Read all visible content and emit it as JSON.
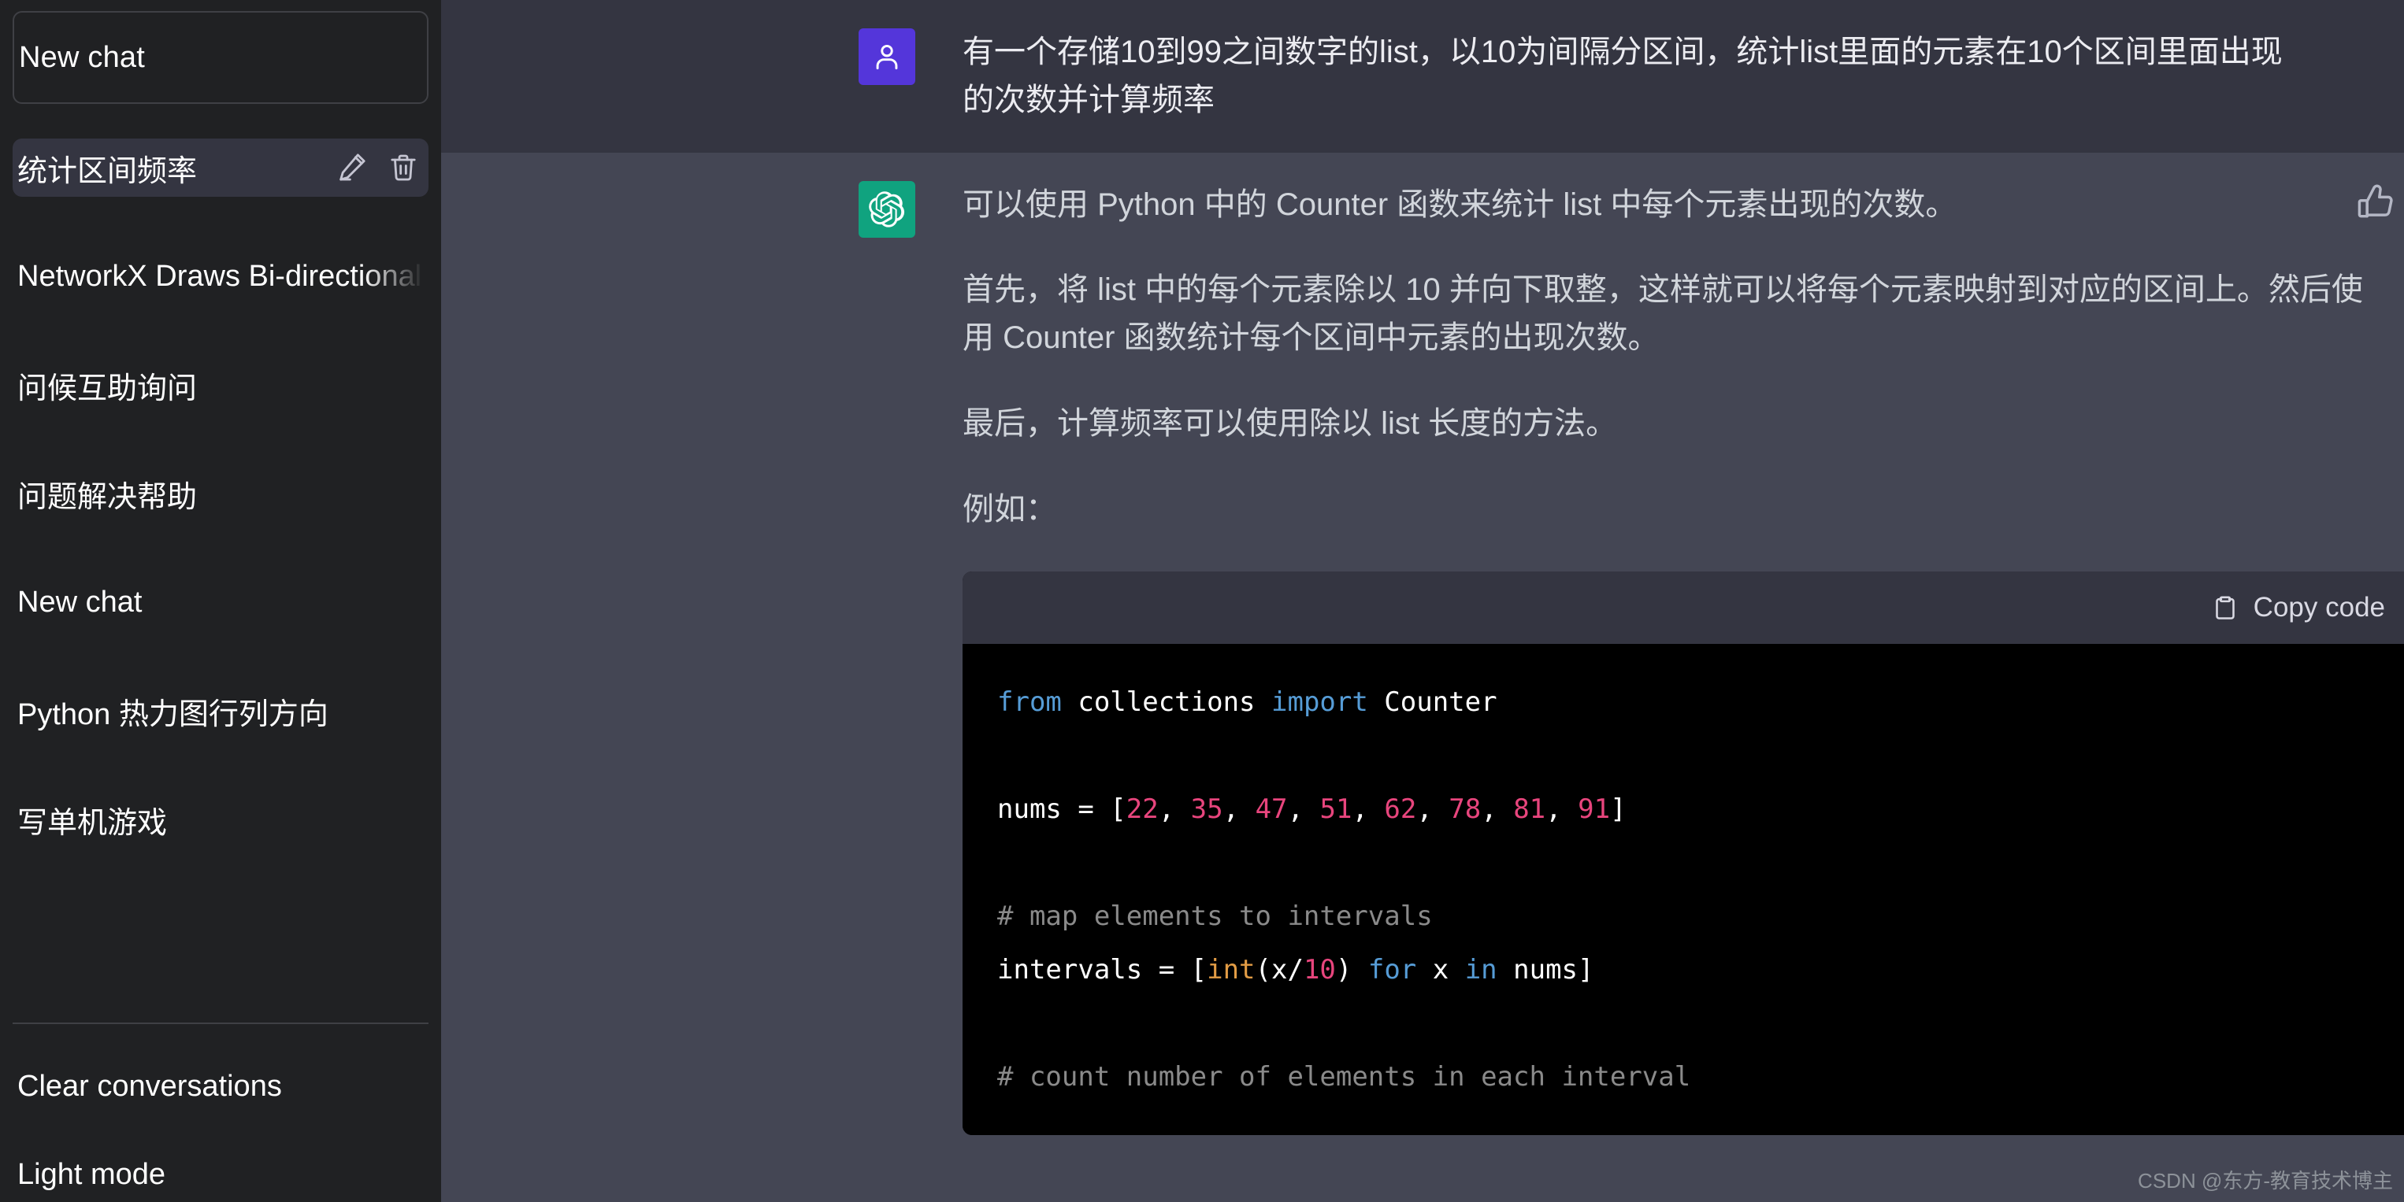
{
  "sidebar": {
    "new_chat_label": "New chat",
    "conversations": [
      {
        "title": "统计区间频率",
        "active": true,
        "edit_icon": "pencil-icon",
        "delete_icon": "trash-icon"
      },
      {
        "title": "NetworkX Draws Bi-directional Edges",
        "active": false
      },
      {
        "title": "问候互助询问",
        "active": false
      },
      {
        "title": "问题解决帮助",
        "active": false
      },
      {
        "title": "New chat",
        "active": false
      },
      {
        "title": "Python 热力图行列方向",
        "active": false
      },
      {
        "title": "写单机游戏",
        "active": false
      }
    ],
    "footer_items": [
      {
        "label": "Clear conversations"
      },
      {
        "label": "Light mode"
      }
    ]
  },
  "conversation": {
    "user_message": {
      "avatar_icon": "user-avatar-icon",
      "avatar_color": "#5436DA",
      "text": "有一个存储10到99之间数字的list，以10为间隔分区间，统计list里面的元素在10个区间里面出现的次数并计算频率"
    },
    "assistant_message": {
      "avatar_icon": "openai-logo-icon",
      "avatar_color": "#10A37F",
      "like_icon": "thumbs-up-icon",
      "paragraphs": [
        "可以使用 Python 中的 Counter 函数来统计 list 中每个元素出现的次数。",
        "首先，将 list 中的每个元素除以 10 并向下取整，这样就可以将每个元素映射到对应的区间上。然后使用 Counter 函数统计每个区间中元素的出现次数。",
        "最后，计算频率可以使用除以 list 长度的方法。",
        "例如："
      ],
      "code_block": {
        "copy_label": "Copy code",
        "copy_icon": "clipboard-icon",
        "lines": [
          [
            {
              "t": "from",
              "c": "kw"
            },
            {
              "t": " collections ",
              "c": "plain"
            },
            {
              "t": "import",
              "c": "kw"
            },
            {
              "t": " Counter",
              "c": "plain"
            }
          ],
          [
            {
              "t": "",
              "c": "plain"
            }
          ],
          [
            {
              "t": "nums = [",
              "c": "plain"
            },
            {
              "t": "22",
              "c": "num"
            },
            {
              "t": ", ",
              "c": "plain"
            },
            {
              "t": "35",
              "c": "num"
            },
            {
              "t": ", ",
              "c": "plain"
            },
            {
              "t": "47",
              "c": "num"
            },
            {
              "t": ", ",
              "c": "plain"
            },
            {
              "t": "51",
              "c": "num"
            },
            {
              "t": ", ",
              "c": "plain"
            },
            {
              "t": "62",
              "c": "num"
            },
            {
              "t": ", ",
              "c": "plain"
            },
            {
              "t": "78",
              "c": "num"
            },
            {
              "t": ", ",
              "c": "plain"
            },
            {
              "t": "81",
              "c": "num"
            },
            {
              "t": ", ",
              "c": "plain"
            },
            {
              "t": "91",
              "c": "num"
            },
            {
              "t": "]",
              "c": "plain"
            }
          ],
          [
            {
              "t": "",
              "c": "plain"
            }
          ],
          [
            {
              "t": "# map elements to intervals",
              "c": "cmt"
            }
          ],
          [
            {
              "t": "intervals = [",
              "c": "plain"
            },
            {
              "t": "int",
              "c": "fn"
            },
            {
              "t": "(x/",
              "c": "plain"
            },
            {
              "t": "10",
              "c": "num"
            },
            {
              "t": ") ",
              "c": "plain"
            },
            {
              "t": "for",
              "c": "kw"
            },
            {
              "t": " x ",
              "c": "plain"
            },
            {
              "t": "in",
              "c": "kw"
            },
            {
              "t": " nums]",
              "c": "plain"
            }
          ],
          [
            {
              "t": "",
              "c": "plain"
            }
          ],
          [
            {
              "t": "# count number of elements in each interval",
              "c": "cmt"
            }
          ]
        ]
      }
    }
  },
  "watermark": {
    "text": "CSDN @东方-教育技术博主"
  },
  "colors": {
    "sidebar_bg": "#202123",
    "user_msg_bg": "#343541",
    "assistant_msg_bg": "#444654",
    "code_bg": "#000000",
    "accent_purple": "#5436DA",
    "accent_green": "#10A37F"
  }
}
